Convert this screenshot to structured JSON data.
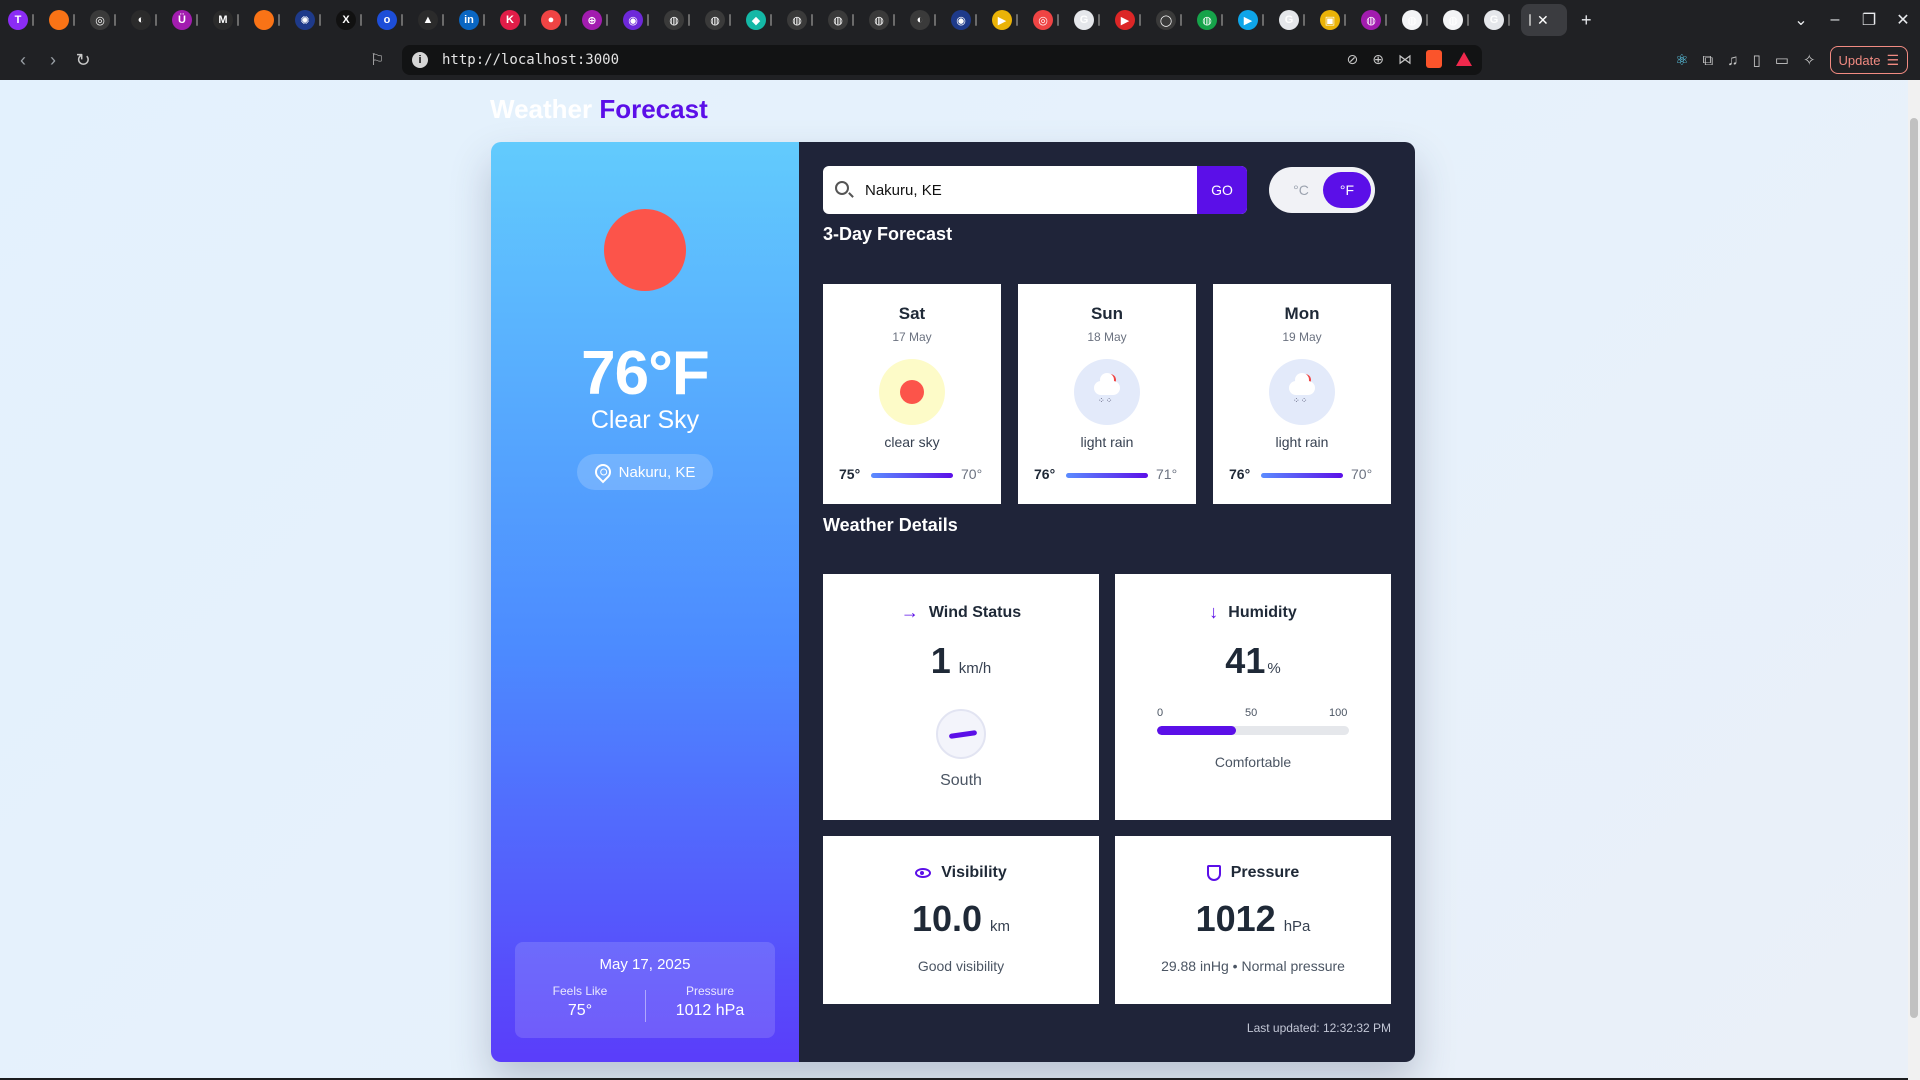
{
  "browser": {
    "url": "http://localhost:3000",
    "update_label": "Update",
    "tabs": [
      {
        "icon": "T",
        "color": "#8b2cf5"
      },
      {
        "icon": "",
        "color": "#f97316"
      },
      {
        "icon": "◎",
        "color": "#3a3a3a"
      },
      {
        "icon": "◐",
        "color": "#2b2b2b"
      },
      {
        "icon": "Ü",
        "color": "#a21caf"
      },
      {
        "icon": "M",
        "color": "#2b2b2b"
      },
      {
        "icon": "",
        "color": "#f97316"
      },
      {
        "icon": "✺",
        "color": "#1e3a8a"
      },
      {
        "icon": "X",
        "color": "#111111"
      },
      {
        "icon": "o",
        "color": "#1d4ed8"
      },
      {
        "icon": "▲",
        "color": "#2b2b2b"
      },
      {
        "icon": "in",
        "color": "#0a66c2"
      },
      {
        "icon": "K",
        "color": "#e11d48"
      },
      {
        "icon": "●",
        "color": "#ef4444"
      },
      {
        "icon": "⊕",
        "color": "#a21caf"
      },
      {
        "icon": "◉",
        "color": "#6d28d9"
      },
      {
        "icon": "◍",
        "color": "#3a3a3a"
      },
      {
        "icon": "◍",
        "color": "#3a3a3a"
      },
      {
        "icon": "◆",
        "color": "#14b8a6"
      },
      {
        "icon": "◍",
        "color": "#3a3a3a"
      },
      {
        "icon": "◍",
        "color": "#3a3a3a"
      },
      {
        "icon": "◍",
        "color": "#3a3a3a"
      },
      {
        "icon": "◐",
        "color": "#3a3a3a"
      },
      {
        "icon": "◉",
        "color": "#1e3a8a"
      },
      {
        "icon": "▶",
        "color": "#eab308"
      },
      {
        "icon": "◎",
        "color": "#ef4444"
      },
      {
        "icon": "G",
        "color": "#e5e7eb"
      },
      {
        "icon": "▶",
        "color": "#dc2626"
      },
      {
        "icon": "◯",
        "color": "#3a3a3a"
      },
      {
        "icon": "◍",
        "color": "#16a34a"
      },
      {
        "icon": "▶",
        "color": "#0ea5e9"
      },
      {
        "icon": "G",
        "color": "#e5e7eb"
      },
      {
        "icon": "▣",
        "color": "#eab308"
      },
      {
        "icon": "◍",
        "color": "#a21caf"
      },
      {
        "icon": "◍",
        "color": "#f3f4f6"
      },
      {
        "icon": "◍",
        "color": "#f3f4f6"
      },
      {
        "icon": "G",
        "color": "#e5e7eb"
      }
    ]
  },
  "app": {
    "title_part1": "Weather",
    "title_part2": "Forecast"
  },
  "current": {
    "temp": "76°F",
    "condition": "Clear Sky",
    "location": "Nakuru, KE",
    "date": "May 17, 2025",
    "feels_like_label": "Feels Like",
    "feels_like": "75°",
    "pressure_label": "Pressure",
    "pressure": "1012 hPa"
  },
  "search": {
    "value": "Nakuru, KE",
    "go_label": "GO"
  },
  "units": {
    "celsius": "°C",
    "fahrenheit": "°F",
    "selected": "F"
  },
  "forecast": {
    "heading": "3-Day Forecast",
    "days": [
      {
        "day": "Sat",
        "date": "17 May",
        "desc": "clear sky",
        "hi": "75°",
        "lo": "70°",
        "icon": "sun-icon",
        "icon_bg": "#fdfbc8"
      },
      {
        "day": "Sun",
        "date": "18 May",
        "desc": "light rain",
        "hi": "76°",
        "lo": "71°",
        "icon": "rain-cloud-icon",
        "icon_bg": "#e3eafa"
      },
      {
        "day": "Mon",
        "date": "19 May",
        "desc": "light rain",
        "hi": "76°",
        "lo": "70°",
        "icon": "rain-cloud-icon",
        "icon_bg": "#e3eafa"
      }
    ]
  },
  "details": {
    "heading": "Weather Details",
    "wind": {
      "title": "Wind Status",
      "value": "1",
      "unit": "km/h",
      "direction": "South"
    },
    "humidity": {
      "title": "Humidity",
      "value": "41",
      "unit": "%",
      "scale_min": "0",
      "scale_mid": "50",
      "scale_max": "100",
      "level": 41,
      "note": "Comfortable"
    },
    "visibility": {
      "title": "Visibility",
      "value": "10.0",
      "unit": "km",
      "note": "Good visibility"
    },
    "pressure": {
      "title": "Pressure",
      "value": "1012",
      "unit": "hPa",
      "note": "29.88 inHg • Normal pressure"
    }
  },
  "last_updated": "Last updated: 12:32:32 PM",
  "colors": {
    "accent": "#5b0fe8",
    "panel_dark": "#1f2439",
    "sun": "#fc544a"
  }
}
